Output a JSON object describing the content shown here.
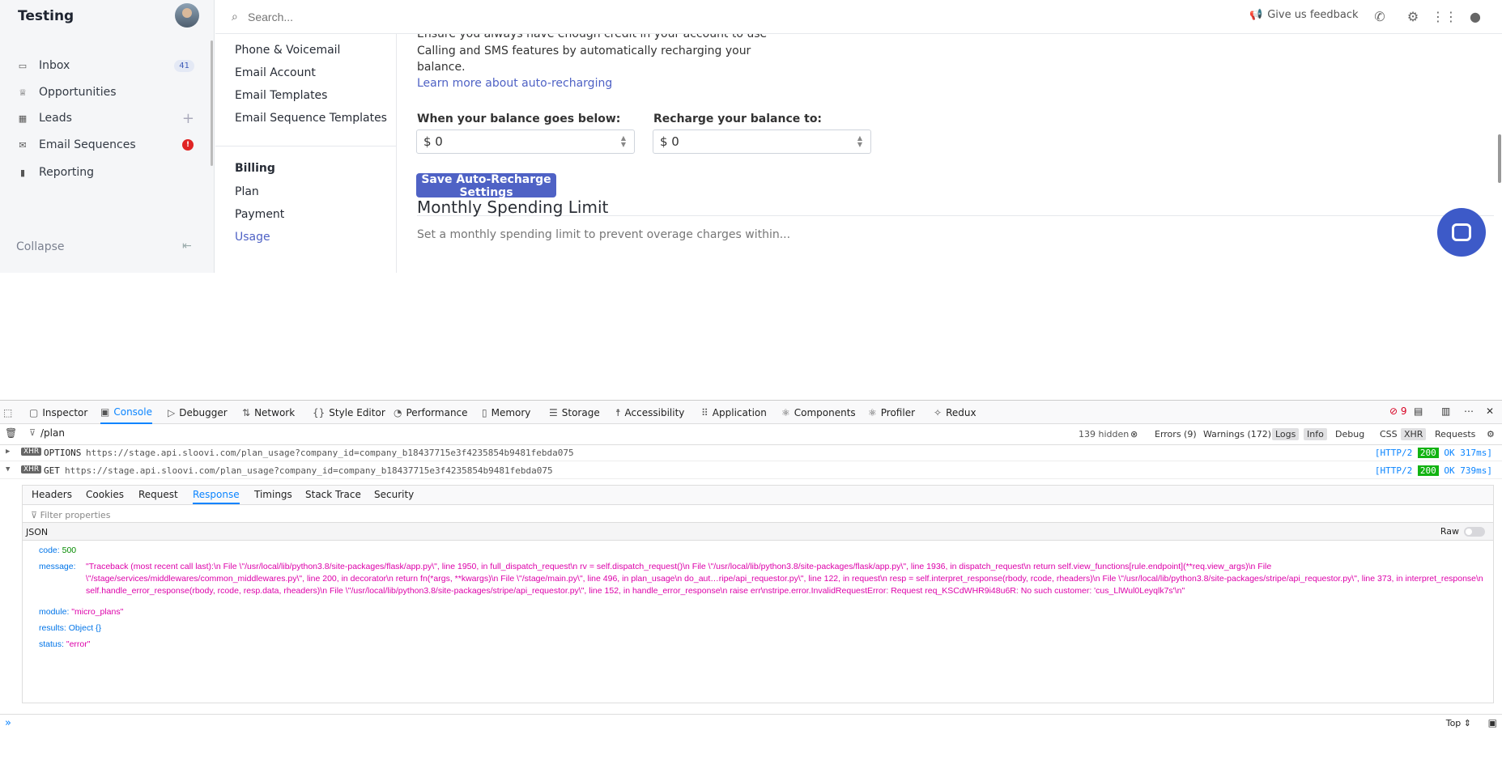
{
  "sidebar": {
    "workspace": "Testing",
    "items": [
      {
        "label": "Inbox",
        "icon": "inbox-icon",
        "badge": "41"
      },
      {
        "label": "Opportunities",
        "icon": "trophy-icon"
      },
      {
        "label": "Leads",
        "icon": "leads-icon"
      },
      {
        "label": "Email Sequences",
        "icon": "mail-icon",
        "alert": "!"
      },
      {
        "label": "Reporting",
        "icon": "bar-chart-icon"
      }
    ],
    "collapse_label": "Collapse"
  },
  "topbar": {
    "search_placeholder": "Search...",
    "feedback_label": "Give us feedback"
  },
  "settings_nav": {
    "links": [
      "Phone & Voicemail",
      "Email Account",
      "Email Templates",
      "Email Sequence Templates"
    ],
    "billing_heading": "Billing",
    "billing_links": [
      "Plan",
      "Payment",
      "Usage"
    ]
  },
  "content": {
    "intro_line1": "Ensure you always have enough credit in your account to use",
    "intro_line2": "Calling and SMS features by automatically recharging your",
    "intro_line3": "balance.",
    "learn_more": "Learn more about auto-recharging",
    "below_label": "When your balance goes below:",
    "below_value": "$ 0",
    "recharge_label": "Recharge your balance to:",
    "recharge_value": "$ 0",
    "save_button": "Save Auto-Recharge Settings",
    "section_title": "Monthly Spending Limit",
    "section_text": "Set a monthly spending limit to prevent overage charges within..."
  },
  "devtools": {
    "tabs": [
      "Inspector",
      "Console",
      "Debugger",
      "Network",
      "Style Editor",
      "Performance",
      "Memory",
      "Storage",
      "Accessibility",
      "Application",
      "Components",
      "Profiler",
      "Redux"
    ],
    "error_count": "9",
    "filter_value": "/plan",
    "hidden_count": "139 hidden",
    "filters": [
      "Errors (9)",
      "Warnings (172)",
      "Logs",
      "Info",
      "Debug",
      "CSS",
      "XHR",
      "Requests"
    ],
    "requests": [
      {
        "method": "OPTIONS",
        "url": "https://stage.api.sloovi.com/plan_usage?company_id=company_b18437715e3f4235854b9481febda075",
        "proto": "[HTTP/2",
        "code": "200",
        "status": "OK 317ms]"
      },
      {
        "method": "GET",
        "url": "https://stage.api.sloovi.com/plan_usage?company_id=company_b18437715e3f4235854b9481febda075",
        "proto": "[HTTP/2",
        "code": "200",
        "status": "OK 739ms]"
      }
    ],
    "xhr_label": "XHR",
    "net_tabs": [
      "Headers",
      "Cookies",
      "Request",
      "Response",
      "Timings",
      "Stack Trace",
      "Security"
    ],
    "filter_props_placeholder": "Filter properties",
    "json_label": "JSON",
    "raw_label": "Raw",
    "json": {
      "code_key": "code:",
      "code_val": "500",
      "message_key": "message:",
      "message_val": "\"Traceback (most recent call last):\\n File \\\"/usr/local/lib/python3.8/site-packages/flask/app.py\\\", line 1950, in full_dispatch_request\\n rv = self.dispatch_request()\\n File \\\"/usr/local/lib/python3.8/site-packages/flask/app.py\\\", line 1936, in dispatch_request\\n return self.view_functions[rule.endpoint](**req.view_args)\\n File \\\"/stage/services/middlewares/common_middlewares.py\\\", line 200, in decorator\\n return fn(*args, **kwargs)\\n File \\\"/stage/main.py\\\", line 496, in plan_usage\\n do_aut…ripe/api_requestor.py\\\", line 122, in request\\n resp = self.interpret_response(rbody, rcode, rheaders)\\n File \\\"/usr/local/lib/python3.8/site-packages/stripe/api_requestor.py\\\", line 373, in interpret_response\\n self.handle_error_response(rbody, rcode, resp.data, rheaders)\\n File \\\"/usr/local/lib/python3.8/site-packages/stripe/api_requestor.py\\\", line 152, in handle_error_response\\n raise err\\nstripe.error.InvalidRequestError: Request req_KSCdWHR9i48u6R: No such customer: 'cus_LlWul0Leyqlk7s'\\n\"",
      "module_key": "module:",
      "module_val": "\"micro_plans\"",
      "results_key": "results:",
      "results_val": "Object {}",
      "status_key": "status:",
      "status_val": "\"error\""
    },
    "context_label": "Top"
  }
}
